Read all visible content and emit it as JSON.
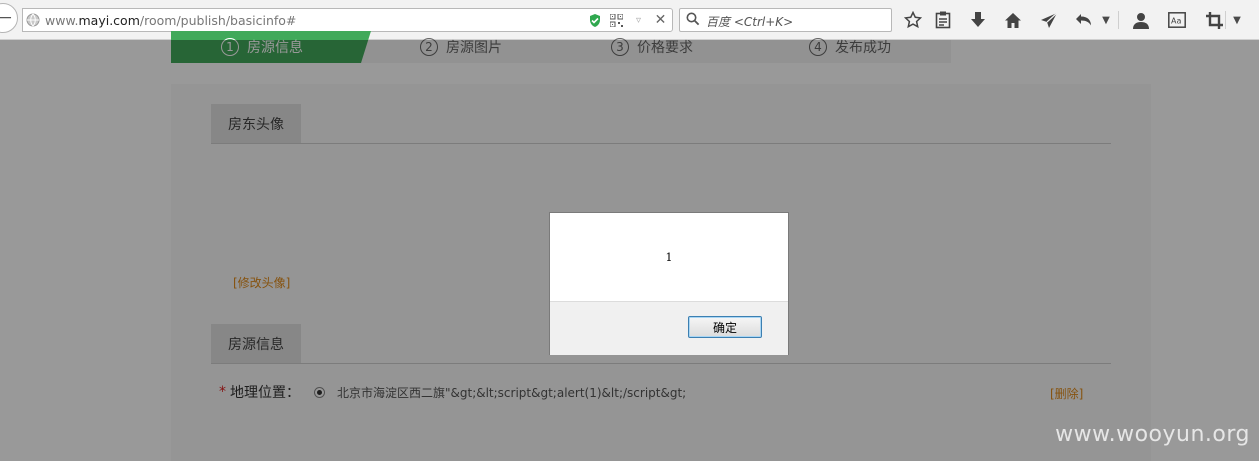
{
  "browser": {
    "url_domain_prefix": "www.",
    "url_domain": "mayi.com",
    "url_path": "/room/publish/basicinfo#",
    "search_placeholder": "百度 <Ctrl+K>",
    "icons": [
      "back-arrow-icon",
      "globe-icon",
      "shield-check-icon",
      "qr-code-icon",
      "dropdown-icon",
      "close-icon",
      "search-icon",
      "star-icon",
      "clipboard-icon",
      "download-icon",
      "home-icon",
      "send-icon",
      "undo-icon",
      "menu-dropdown-icon",
      "user-icon",
      "reader-icon",
      "crop-icon",
      "overflow-dropdown-icon"
    ]
  },
  "steps": [
    {
      "num": "1",
      "label": "房源信息",
      "active": true
    },
    {
      "num": "2",
      "label": "房源图片",
      "active": false
    },
    {
      "num": "3",
      "label": "价格要求",
      "active": false
    },
    {
      "num": "4",
      "label": "发布成功",
      "active": false
    }
  ],
  "sections": {
    "avatar_title": "房东头像",
    "edit_avatar": "[修改头像]",
    "room_title": "房源信息"
  },
  "location_field": {
    "required_mark": "*",
    "label": "地理位置：",
    "value": "北京市海淀区西二旗\"&gt;&lt;script&gt;alert(1)&lt;/script&gt;",
    "delete": "[删除]"
  },
  "dialog": {
    "message": "1",
    "ok_label": "确定"
  },
  "watermark": "www.wooyun.org",
  "colors": {
    "step_active": "#41a95a",
    "link_orange": "#e08a1a",
    "overlay": "rgba(0,0,0,0.40)"
  }
}
